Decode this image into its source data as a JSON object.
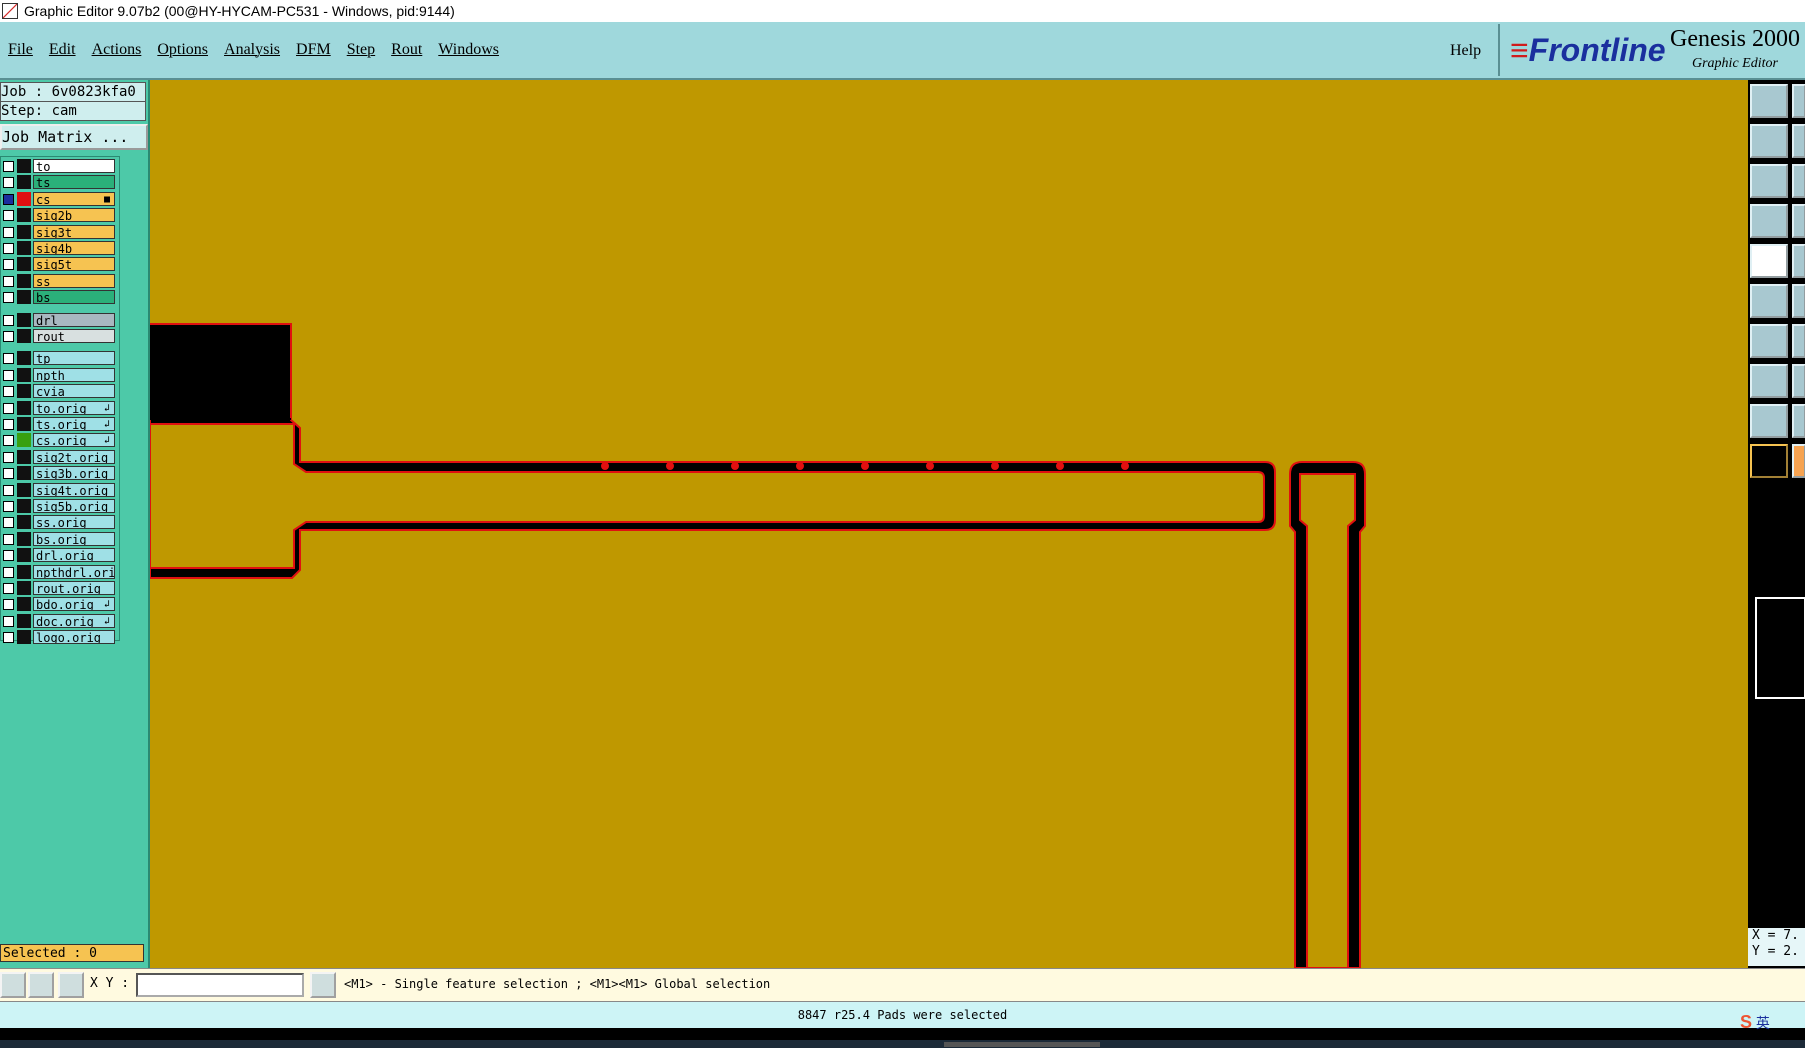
{
  "window": {
    "title": "Graphic Editor 9.07b2 (00@HY-HYCAM-PC531 - Windows, pid:9144)"
  },
  "menu": {
    "items": [
      "File",
      "Edit",
      "Actions",
      "Options",
      "Analysis",
      "DFM",
      "Step",
      "Rout",
      "Windows"
    ],
    "help": "Help"
  },
  "brand": {
    "logo": "Frontline",
    "product": "Genesis 2000",
    "subtitle": "Graphic Editor"
  },
  "job": {
    "job_label": "Job : 6v0823kfa0",
    "step_label": "Step: cam",
    "matrix_button": "Job Matrix ..."
  },
  "layers": [
    {
      "name": "to",
      "color": "#ffffff",
      "swatch": "#111111",
      "mark": ""
    },
    {
      "name": "ts",
      "color": "#2bb07a",
      "swatch": "#111111",
      "mark": ""
    },
    {
      "name": "cs",
      "color": "#f6c351",
      "swatch": "#e01010",
      "mark": "■",
      "active": true
    },
    {
      "name": "sig2b",
      "color": "#f6c351",
      "swatch": "#111111",
      "mark": ""
    },
    {
      "name": "sig3t",
      "color": "#f6c351",
      "swatch": "#111111",
      "mark": ""
    },
    {
      "name": "sig4b",
      "color": "#f6c351",
      "swatch": "#111111",
      "mark": ""
    },
    {
      "name": "sig5t",
      "color": "#f6c351",
      "swatch": "#111111",
      "mark": ""
    },
    {
      "name": "ss",
      "color": "#f6c351",
      "swatch": "#111111",
      "mark": ""
    },
    {
      "name": "bs",
      "color": "#2bb07a",
      "swatch": "#111111",
      "mark": ""
    },
    {
      "name": "drl",
      "color": "#a8b8c0",
      "swatch": "#111111",
      "mark": ""
    },
    {
      "name": "rout",
      "color": "#d8e0e0",
      "swatch": "#111111",
      "mark": ""
    },
    {
      "name": "tp",
      "color": "#9fe0e6",
      "swatch": "#111111",
      "mark": ""
    },
    {
      "name": "npth",
      "color": "#9fe0e6",
      "swatch": "#111111",
      "mark": ""
    },
    {
      "name": "cvia",
      "color": "#9fe0e6",
      "swatch": "#111111",
      "mark": ""
    },
    {
      "name": "to.orig",
      "color": "#9fe0e6",
      "swatch": "#111111",
      "mark": "↲"
    },
    {
      "name": "ts.orig",
      "color": "#9fe0e6",
      "swatch": "#111111",
      "mark": "↲"
    },
    {
      "name": "cs.orig",
      "color": "#9fe0e6",
      "swatch": "#38a010",
      "mark": "↲"
    },
    {
      "name": "sig2t.orig",
      "color": "#9fe0e6",
      "swatch": "#111111",
      "mark": ""
    },
    {
      "name": "sig3b.orig",
      "color": "#9fe0e6",
      "swatch": "#111111",
      "mark": ""
    },
    {
      "name": "sig4t.orig",
      "color": "#9fe0e6",
      "swatch": "#111111",
      "mark": ""
    },
    {
      "name": "sig5b.orig",
      "color": "#9fe0e6",
      "swatch": "#111111",
      "mark": ""
    },
    {
      "name": "ss.orig",
      "color": "#9fe0e6",
      "swatch": "#111111",
      "mark": ""
    },
    {
      "name": "bs.orig",
      "color": "#9fe0e6",
      "swatch": "#111111",
      "mark": ""
    },
    {
      "name": "drl.orig",
      "color": "#9fe0e6",
      "swatch": "#111111",
      "mark": ""
    },
    {
      "name": "npthdrl.orig",
      "color": "#9fe0e6",
      "swatch": "#111111",
      "mark": ""
    },
    {
      "name": "rout.orig",
      "color": "#9fe0e6",
      "swatch": "#111111",
      "mark": ""
    },
    {
      "name": "bdo.orig",
      "color": "#9fe0e6",
      "swatch": "#111111",
      "mark": "↲"
    },
    {
      "name": "doc.orig",
      "color": "#9fe0e6",
      "swatch": "#111111",
      "mark": "↲"
    },
    {
      "name": "logo.orig",
      "color": "#9fe0e6",
      "swatch": "#111111",
      "mark": ""
    }
  ],
  "selected_label": "Selected : 0",
  "coords": {
    "x": "X = 7.",
    "y": "Y = 2."
  },
  "command": {
    "xy_label": "X Y :",
    "xy_value": "",
    "prompt": "<M1> - Single feature selection ; <M1><M1> Global selection"
  },
  "status": {
    "message": "8847 r25.4 Pads were selected"
  },
  "ime": {
    "label": "英"
  },
  "colors": {
    "canvas": "#bf9800",
    "panel": "#4dc9a8",
    "menubar": "#9fd8dc",
    "outline": "#e01010"
  }
}
